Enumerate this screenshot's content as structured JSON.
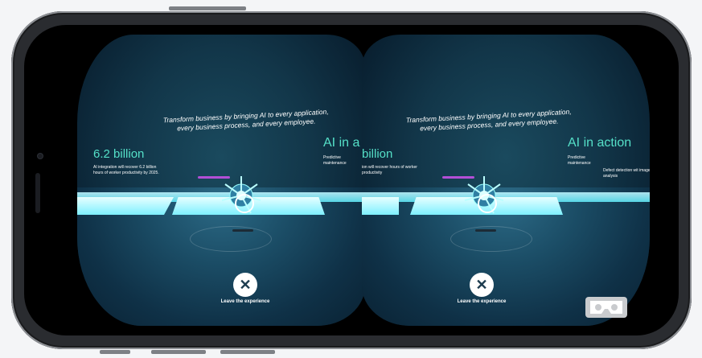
{
  "tagline": "Transform business by bringing AI to every application, every business process, and every employee.",
  "stat": {
    "value": "6.2 billion",
    "left_value": "billion",
    "description": "AI integration will recover 6.2 billion hours of worker productivity by 2025.",
    "left_description": "ion will recover hours of worker productivity"
  },
  "ai_section": {
    "title": "AI in action",
    "title_clipped": "AI in a",
    "item1": "Predictive maintenance",
    "item2": "Defect detection with image analysis",
    "item2_clipped": "Defect detection wit image analysis"
  },
  "leave": {
    "label": "Leave the experience",
    "icon": "close-icon"
  },
  "cardboard_icon": "vr-headset-icon"
}
